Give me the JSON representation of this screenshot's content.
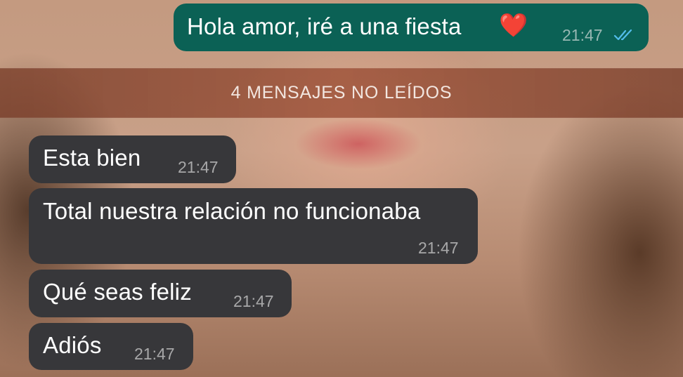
{
  "chat": {
    "outgoing": [
      {
        "text": "Hola amor, iré a una fiesta",
        "emoji": "❤️",
        "time": "21:47",
        "status": "read-double-check"
      }
    ],
    "unread_divider": "4 MENSAJES NO LEÍDOS",
    "incoming": [
      {
        "text": "Esta bien",
        "time": "21:47"
      },
      {
        "text": "Total nuestra relación no funcionaba",
        "time": "21:47"
      },
      {
        "text": "Qué seas feliz",
        "time": "21:47"
      },
      {
        "text": "Adiós",
        "time": "21:47"
      }
    ]
  },
  "colors": {
    "outgoing_bubble": "#0b6155",
    "incoming_bubble": "#37373a",
    "read_check": "#53bdeb"
  }
}
